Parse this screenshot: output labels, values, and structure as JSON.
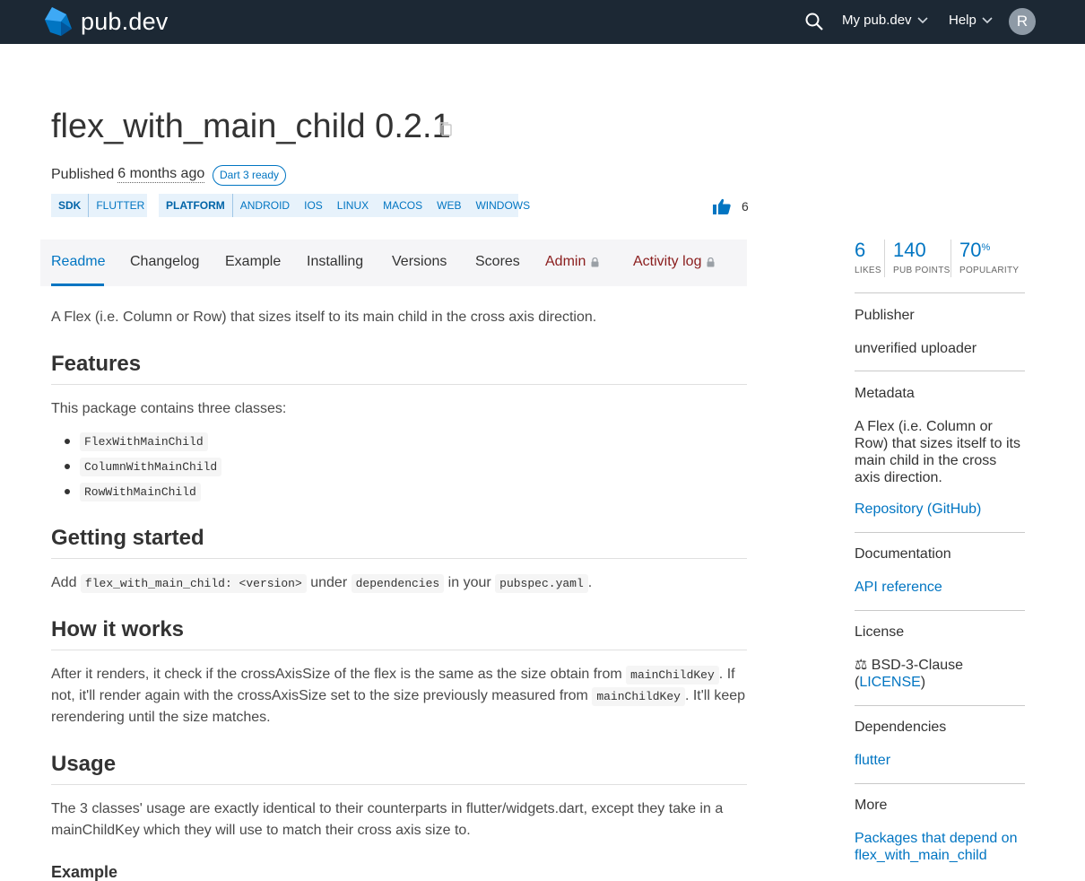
{
  "header": {
    "logo_text": "pub.dev",
    "nav_my": "My pub.dev",
    "nav_help": "Help",
    "avatar_letter": "R"
  },
  "package": {
    "title": "flex_with_main_child 0.2.1",
    "published_label": "Published",
    "published_ago": "6 months ago",
    "badge": "Dart 3 ready",
    "sdk_head": "SDK",
    "sdk_tags": [
      "FLUTTER"
    ],
    "platform_head": "PLATFORM",
    "platform_tags": [
      "ANDROID",
      "IOS",
      "LINUX",
      "MACOS",
      "WEB",
      "WINDOWS"
    ],
    "likes_count": "6"
  },
  "tabs": [
    "Readme",
    "Changelog",
    "Example",
    "Installing",
    "Versions",
    "Scores",
    "Admin",
    "Activity log"
  ],
  "readme": {
    "intro": "A Flex (i.e. Column or Row) that sizes itself to its main child in the cross axis direction.",
    "features_heading": "Features",
    "features_text": "This package contains three classes:",
    "classes": [
      "FlexWithMainChild",
      "ColumnWithMainChild",
      "RowWithMainChild"
    ],
    "getting_started_heading": "Getting started",
    "gs_add": "Add",
    "gs_code1": "flex_with_main_child: <version>",
    "gs_under": "under",
    "gs_code2": "dependencies",
    "gs_in": "in your",
    "gs_code3": "pubspec.yaml",
    "gs_end": ".",
    "how_heading": "How it works",
    "how_text1": "After it renders, it check if the crossAxisSize of the flex is the same as the size obtain from",
    "how_code": "mainChildKey",
    "how_text2": ". If",
    "how_text3": "not, it'll render again with the crossAxisSize set to the size previously measured from",
    "how_text4": ". It'll keep",
    "how_text5": "rerendering until the size matches.",
    "usage_heading": "Usage",
    "usage_text1": "The 3 classes' usage are exactly identical to their counterparts in flutter/widgets.dart, except they take in a",
    "usage_text2": "mainChildKey which they will use to match their cross axis size to.",
    "example_heading": "Example"
  },
  "sidebar": {
    "likes_value": "6",
    "likes_label": "LIKES",
    "points_value": "140",
    "points_label": "PUB POINTS",
    "popularity_value": "70",
    "popularity_unit": "%",
    "popularity_label": "POPULARITY",
    "publisher_heading": "Publisher",
    "publisher_value": "unverified uploader",
    "metadata_heading": "Metadata",
    "metadata_desc": "A Flex (i.e. Column or Row) that sizes itself to its main child in the cross axis direction.",
    "repository_link": "Repository (GitHub)",
    "documentation_heading": "Documentation",
    "api_link": "API reference",
    "license_heading": "License",
    "license_value": "BSD-3-Clause",
    "license_link": "LICENSE",
    "dependencies_heading": "Dependencies",
    "dependency_link": "flutter",
    "more_heading": "More",
    "more_link": "Packages that depend on flex_with_main_child"
  },
  "colors": {
    "header_bg": "#1c2834",
    "link": "#0175c2",
    "admin": "#8a1d1d"
  }
}
